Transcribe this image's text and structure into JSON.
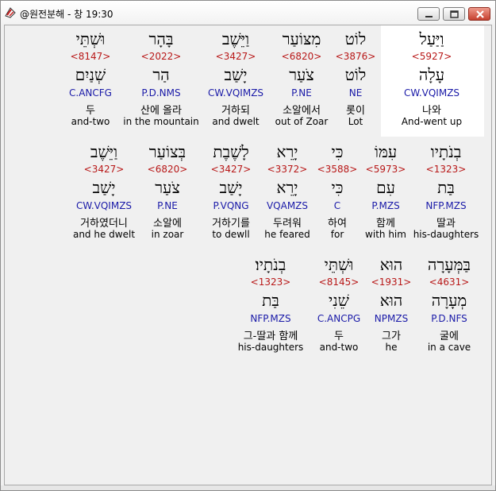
{
  "window": {
    "title": "@원전분해 - 창 19:30"
  },
  "rows": [
    {
      "words": [
        {
          "hebrew": "וַיַּעַל",
          "strong": "<5927>",
          "lemma": "עָלָה",
          "grammar": "CW.VQIMZS",
          "korean": "나와",
          "english": "And-went up"
        },
        {
          "hebrew": "לוֹט",
          "strong": "<3876>",
          "lemma": "לוֹט",
          "grammar": "NE",
          "korean": "롯이",
          "english": "Lot"
        },
        {
          "hebrew": "מִצּוֹעַר",
          "strong": "<6820>",
          "lemma": "צֹעַר",
          "grammar": "P.NE",
          "korean": "소알에서",
          "english": "out of Zoar"
        },
        {
          "hebrew": "וַיֵּשֶׁב",
          "strong": "<3427>",
          "lemma": "יָשַׁב",
          "grammar": "CW.VQIMZS",
          "korean": "거하되",
          "english": "and dwelt"
        },
        {
          "hebrew": "בָּהָר",
          "strong": "<2022>",
          "lemma": "הַר",
          "grammar": "P.D.NMS",
          "korean": "산에 올라",
          "english": "in the mountain"
        },
        {
          "hebrew": "וּשְׁתֵּי",
          "strong": "<8147>",
          "lemma": "שְׁנַיִם",
          "grammar": "C.ANCFG",
          "korean": "두",
          "english": "and-two"
        }
      ]
    },
    {
      "words": [
        {
          "hebrew": "בְנֹתָיו",
          "strong": "<1323>",
          "lemma": "בַּת",
          "grammar": "NFP.MZS",
          "korean": "딸과",
          "english": "his-daughters"
        },
        {
          "hebrew": "עִמּוֹ",
          "strong": "<5973>",
          "lemma": "עִם",
          "grammar": "P.MZS",
          "korean": "함께",
          "english": "with him"
        },
        {
          "hebrew": "כִּי",
          "strong": "<3588>",
          "lemma": "כִּי",
          "grammar": "C",
          "korean": "하여",
          "english": "for"
        },
        {
          "hebrew": "יָרֵא",
          "strong": "<3372>",
          "lemma": "יָרֵא",
          "grammar": "VQAMZS",
          "korean": "두려워",
          "english": "he feared"
        },
        {
          "hebrew": "לָשֶׁבֶת",
          "strong": "<3427>",
          "lemma": "יָשַׁב",
          "grammar": "P.VQNG",
          "korean": "거하기를",
          "english": "to dewll"
        },
        {
          "hebrew": "בְּצוֹעַר",
          "strong": "<6820>",
          "lemma": "צֹעַר",
          "grammar": "P.NE",
          "korean": "소알에",
          "english": "in zoar"
        },
        {
          "hebrew": "וַיֵּשֶׁב",
          "strong": "<3427>",
          "lemma": "יָשַׁב",
          "grammar": "CW.VQIMZS",
          "korean": "거하였더니",
          "english": "and he dwelt"
        }
      ]
    },
    {
      "words": [
        {
          "hebrew": "בַּמְּעָרָה",
          "strong": "<4631>",
          "lemma": "מְעָרָה",
          "grammar": "P.D.NFS",
          "korean": "굴에",
          "english": "in a cave"
        },
        {
          "hebrew": "הוּא",
          "strong": "<1931>",
          "lemma": "הוּא",
          "grammar": "NPMZS",
          "korean": "그가",
          "english": "he"
        },
        {
          "hebrew": "וּשְׁתֵּי",
          "strong": "<8145>",
          "lemma": "שֵׁנִי",
          "grammar": "C.ANCPG",
          "korean": "두",
          "english": "and-two"
        },
        {
          "hebrew": "בְנֹתָיו׃",
          "strong": "<1323>",
          "lemma": "בַּת",
          "grammar": "NFP.MZS",
          "korean": "그-딸과 함께",
          "english": "his-daughters"
        }
      ]
    }
  ],
  "colors": {
    "strong": "#b81818",
    "grammar": "#1a1aa8",
    "highlight": "#ffffff",
    "background": "#f0f0f0"
  },
  "icons": {
    "app": "app-logo-icon",
    "minimize": "minimize-icon",
    "maximize": "maximize-icon",
    "close": "close-icon"
  }
}
